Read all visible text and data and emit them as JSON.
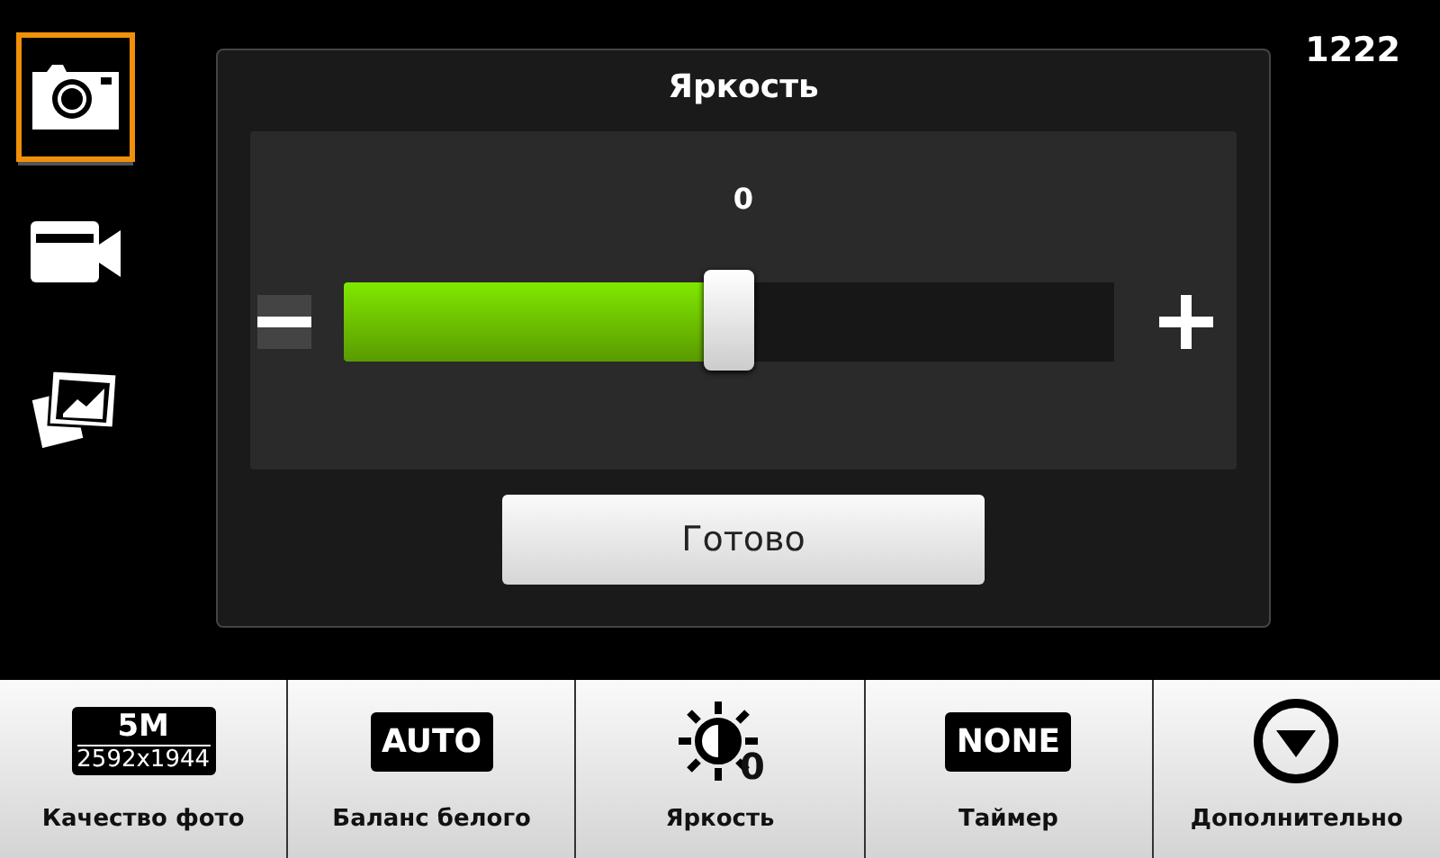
{
  "modes": [
    {
      "kind": "camera",
      "selected": true
    },
    {
      "kind": "video",
      "selected": false
    },
    {
      "kind": "gallery",
      "selected": false
    }
  ],
  "counter": "1222",
  "dialog": {
    "title": "Яркость",
    "value": "0",
    "slider": {
      "level": 0.5
    },
    "done_button": "Готово"
  },
  "settings": [
    {
      "kind": "quality",
      "top": "5M",
      "bottom": "2592x1944",
      "label": "Качество фото"
    },
    {
      "kind": "badge",
      "text": "AUTO",
      "label": "Баланс белого"
    },
    {
      "kind": "brightness",
      "value": "0",
      "label": "Яркость"
    },
    {
      "kind": "badge",
      "text": "NONE",
      "label": "Таймер"
    },
    {
      "kind": "more",
      "label": "Дополнительно"
    }
  ]
}
